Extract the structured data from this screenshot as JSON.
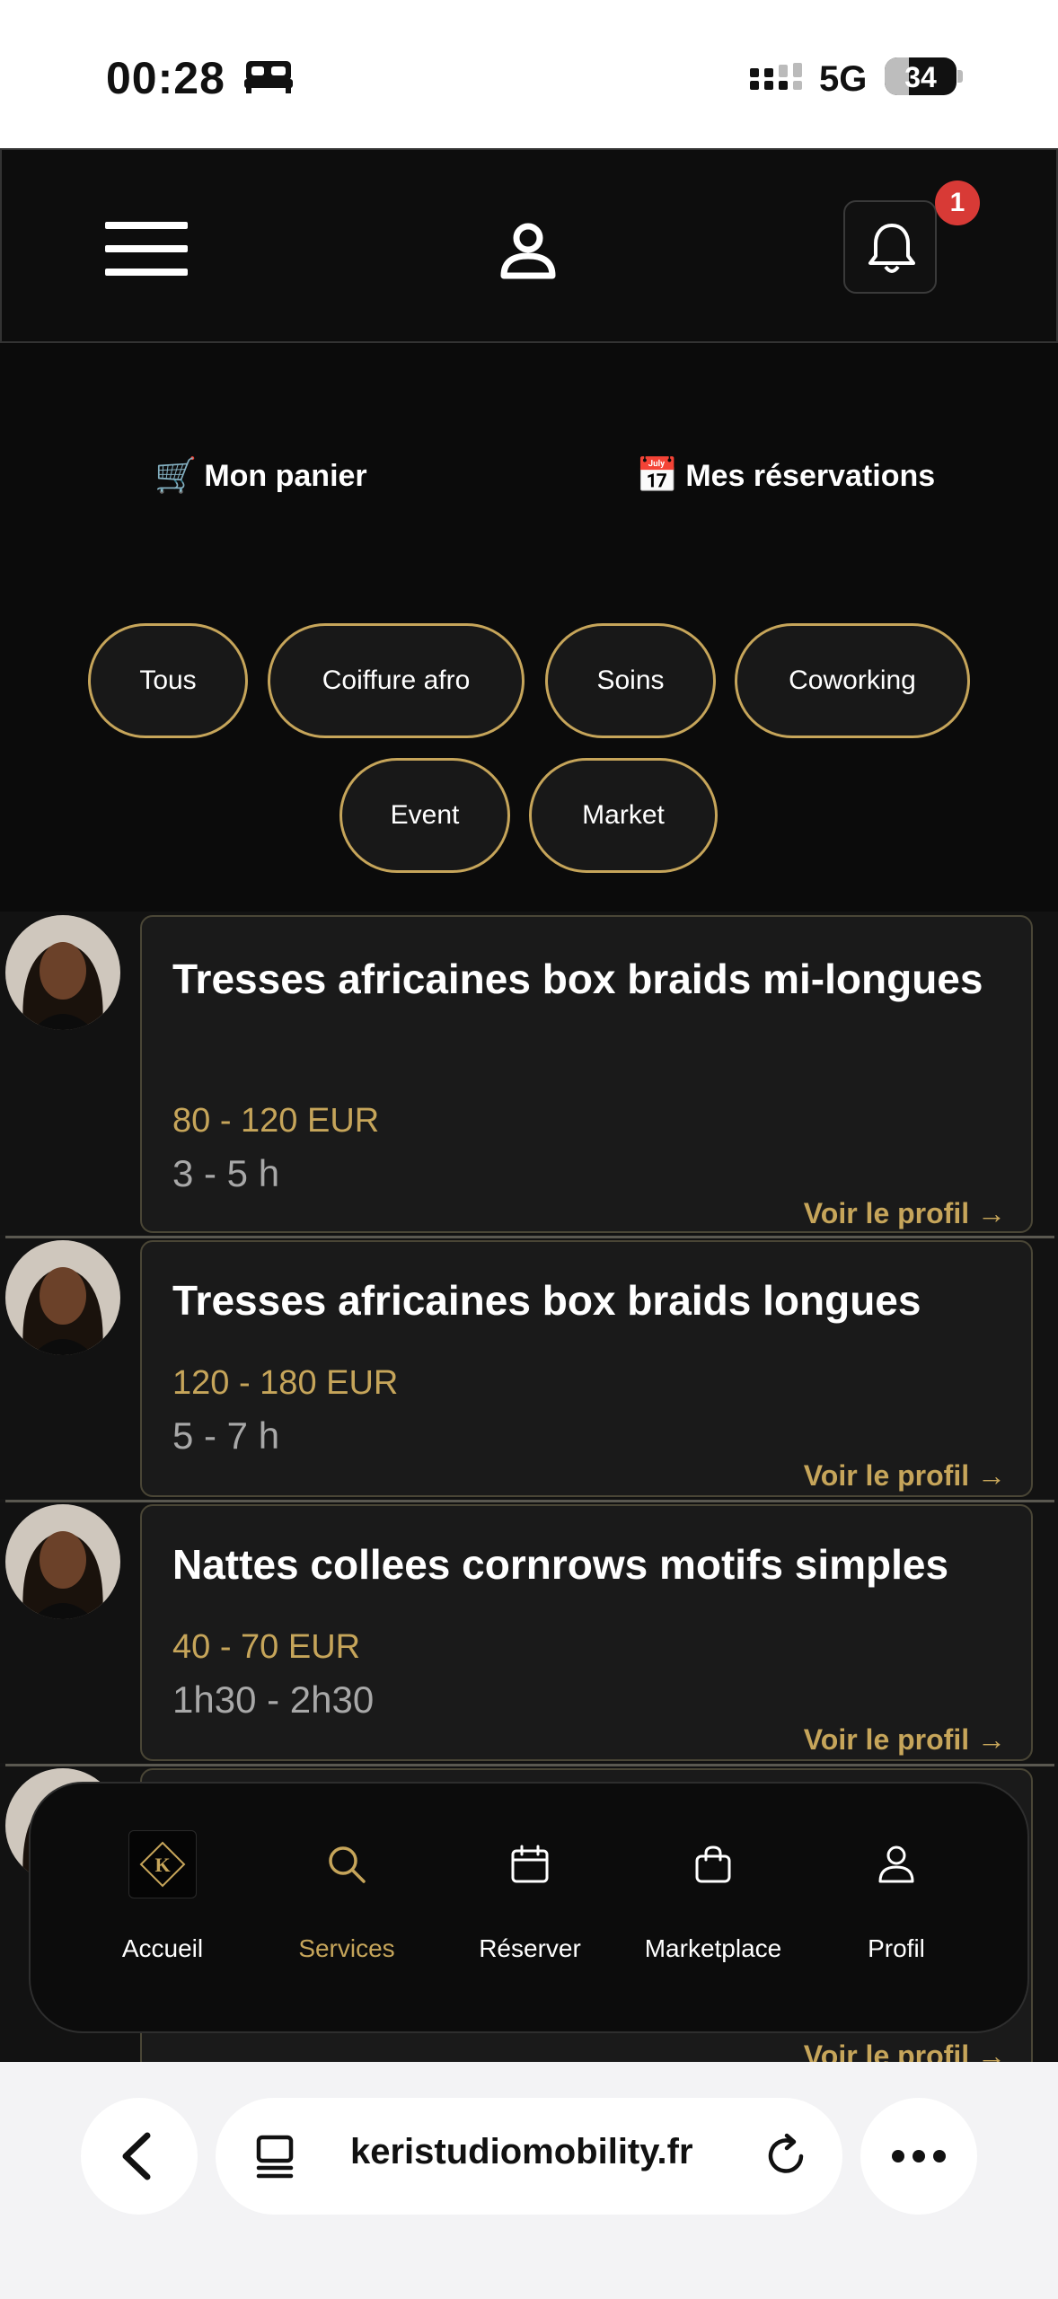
{
  "status_bar": {
    "time": "00:28",
    "network": "5G",
    "battery": "34",
    "battery_level": 0.34
  },
  "header": {
    "notification_count": "1"
  },
  "quick_links": {
    "cart": {
      "emoji": "🛒",
      "label": "Mon panier"
    },
    "bookings": {
      "emoji": "📅",
      "label": "Mes réservations"
    }
  },
  "categories": [
    {
      "label": "Tous"
    },
    {
      "label": "Coiffure afro"
    },
    {
      "label": "Soins"
    },
    {
      "label": "Coworking"
    },
    {
      "label": "Event"
    },
    {
      "label": "Market"
    }
  ],
  "services": [
    {
      "title": "Tresses africaines box braids mi-longues",
      "price": "80 - 120 EUR",
      "duration": "3 - 5 h",
      "link": "Voir le profil →"
    },
    {
      "title": "Tresses africaines box braids longues",
      "price": "120 - 180 EUR",
      "duration": "5 - 7 h",
      "link": "Voir le profil →"
    },
    {
      "title": "Nattes collees cornrows motifs simples",
      "price": "40 - 70 EUR",
      "duration": "1h30 - 2h30",
      "link": "Voir le profil →"
    },
    {
      "title": "",
      "price": "",
      "duration": "",
      "link": "Voir le profil →"
    }
  ],
  "bottom_nav": [
    {
      "label": "Accueil",
      "icon": "logo-k-icon"
    },
    {
      "label": "Services",
      "icon": "search-icon",
      "active": true
    },
    {
      "label": "Réserver",
      "icon": "calendar-icon"
    },
    {
      "label": "Marketplace",
      "icon": "shopping-bag-icon"
    },
    {
      "label": "Profil",
      "icon": "user-icon"
    }
  ],
  "browser": {
    "url": "keristudiomobility.fr"
  },
  "colors": {
    "accent_gold": "#c6a55a",
    "badge_red": "#d83a36",
    "background": "#0b0b0b"
  }
}
